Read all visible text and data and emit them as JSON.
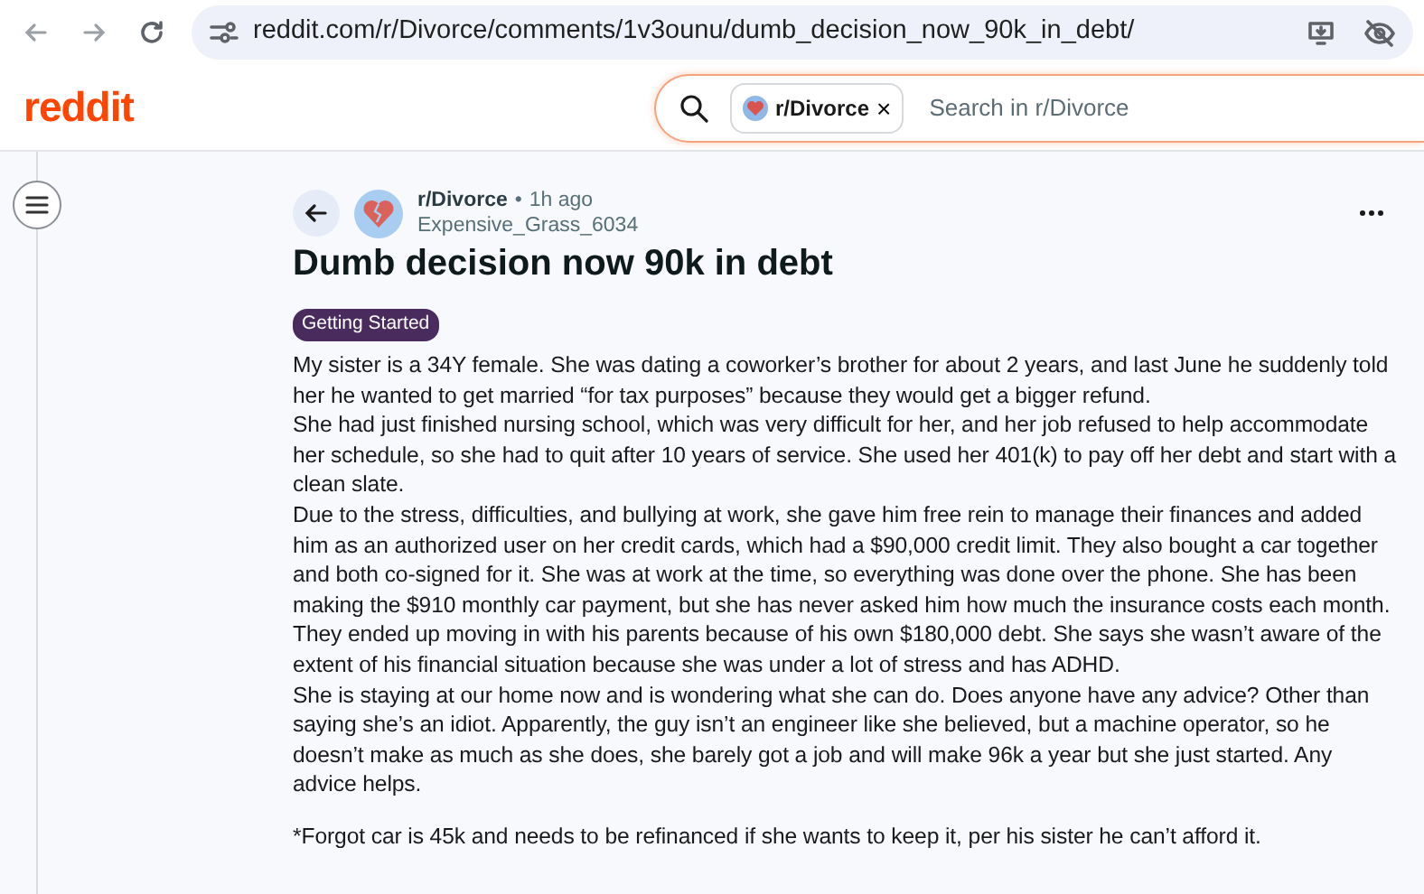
{
  "browser": {
    "url": "reddit.com/r/Divorce/comments/1v3ounu/dumb_decision_now_90k_in_debt/"
  },
  "header": {
    "logo": "reddit",
    "search": {
      "chip": "r/Divorce",
      "chip_close": "×",
      "placeholder": "Search in r/Divorce"
    }
  },
  "post": {
    "subreddit": "r/Divorce",
    "separator": "•",
    "time": "1h ago",
    "author": "Expensive_Grass_6034",
    "title": "Dumb decision now 90k in debt",
    "flair": "Getting Started",
    "paragraphs": [
      "My sister is a 34Y female. She was dating a coworker’s brother for about 2 years, and last June he suddenly told her he wanted to get married “for tax purposes” because they would get a bigger refund.",
      "She had just finished nursing school, which was very difficult for her, and her job refused to help accommodate her schedule, so she had to quit after 10 years of service. She used her 401(k) to pay off her debt and start with a clean slate.",
      "Due to the stress, difficulties, and bullying at work, she gave him free rein to manage their finances and added him as an authorized user on her credit cards, which had a $90,000 credit limit. They also bought a car together and both co-signed for it. She was at work at the time, so everything was done over the phone. She has been making the $910 monthly car payment, but she has never asked him how much the insurance costs each month. They ended up moving in with his parents because of his own $180,000 debt. She says she wasn’t aware of the extent of his financial situation because she was under a lot of stress and has ADHD.",
      "She is staying at our home now and is wondering what she can do. Does anyone have any advice? Other than saying she’s an idiot. Apparently, the guy isn’t an engineer like she believed, but a machine operator, so he doesn’t make as much as she does, she barely got a job and will make 96k a year but she just started. Any advice helps."
    ],
    "footnote": "*Forgot car is 45k and needs to be refinanced if she wants to keep it, per his sister he can’t afford it."
  }
}
